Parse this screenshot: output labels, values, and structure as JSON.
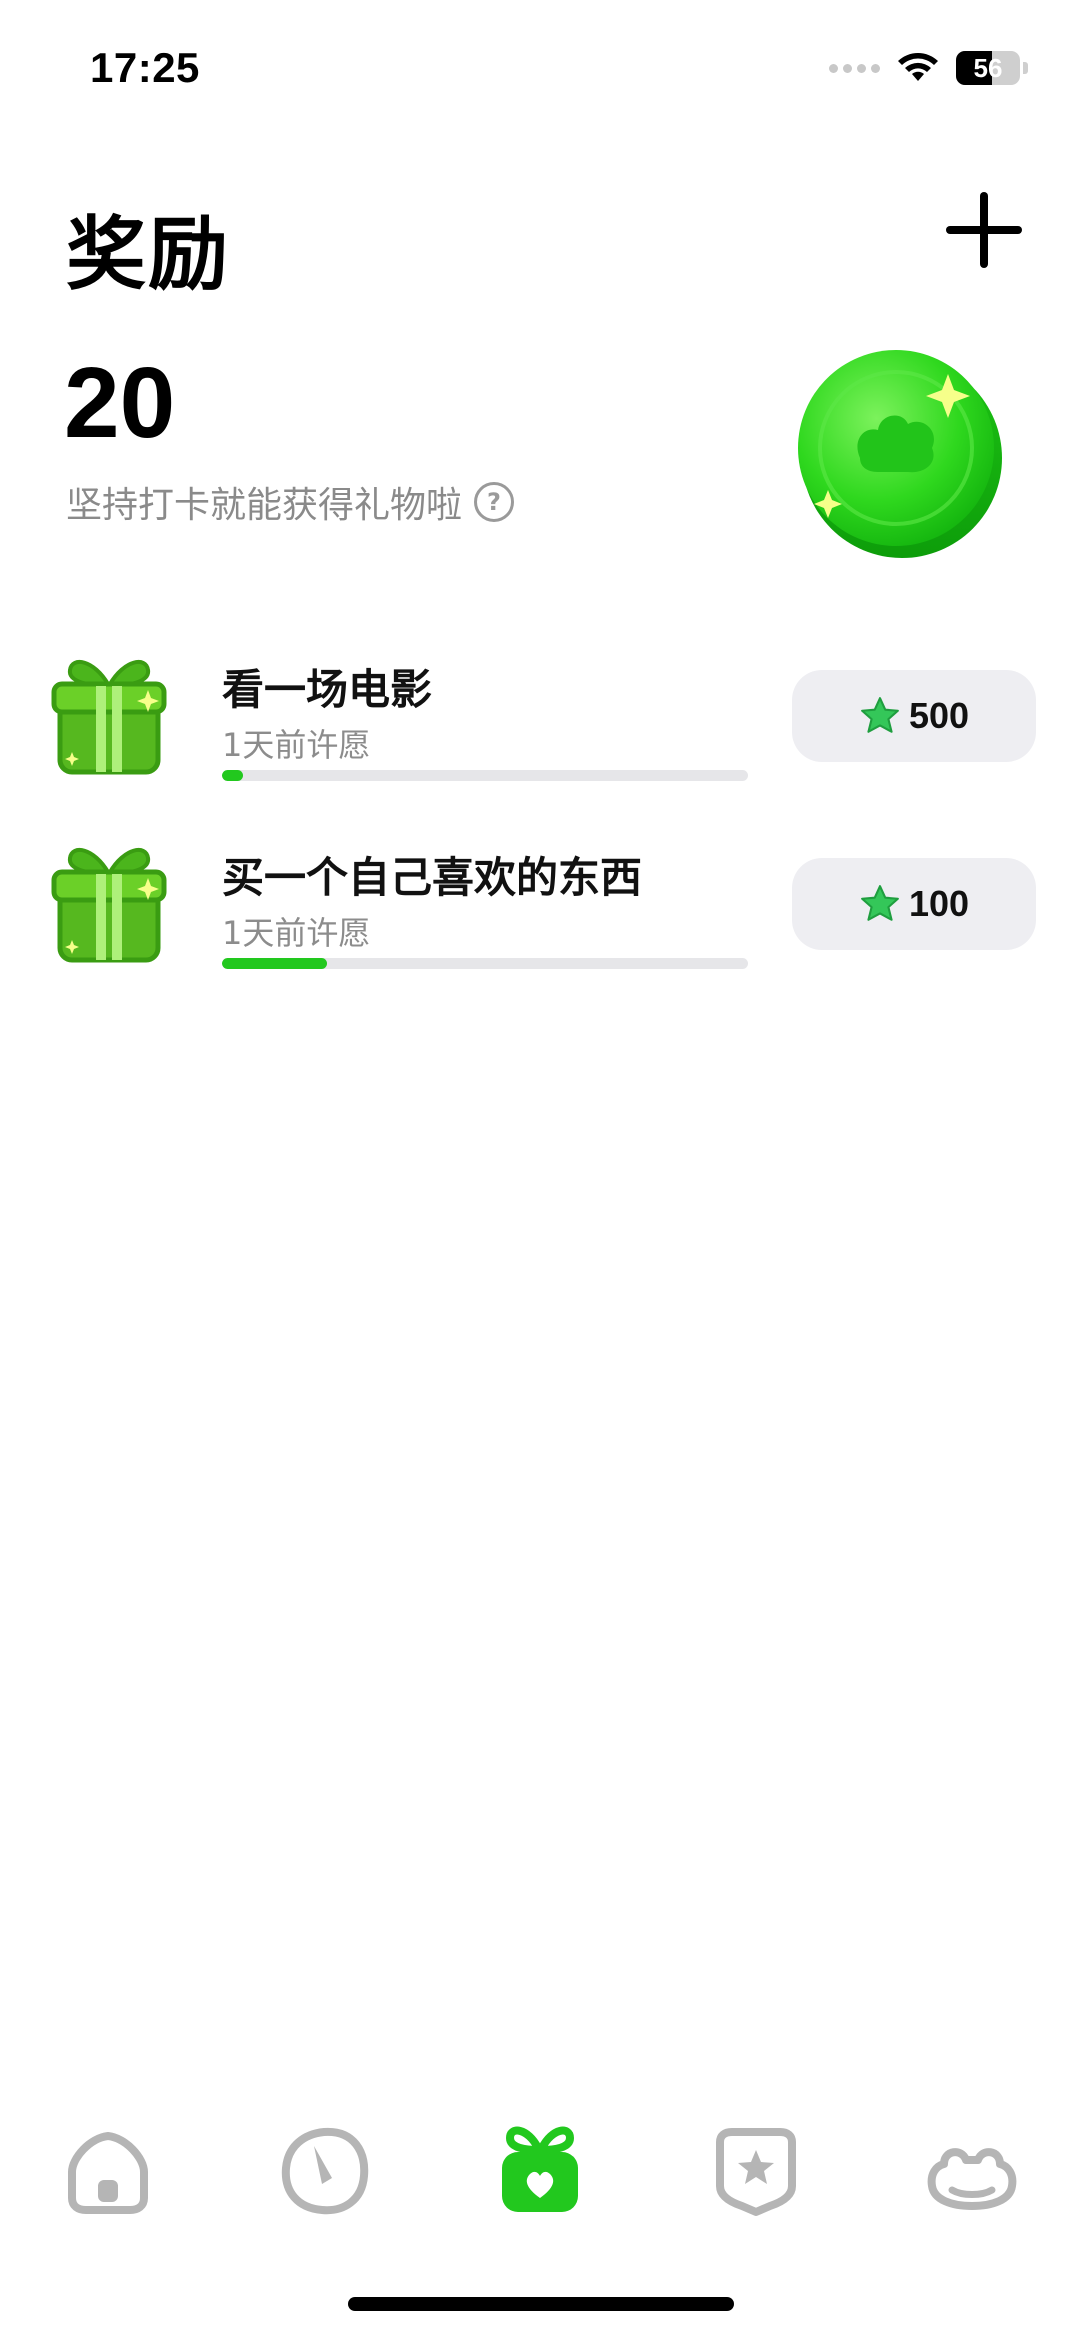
{
  "status_bar": {
    "time": "17:25",
    "battery": "56"
  },
  "header": {
    "title": "奖励"
  },
  "points": {
    "value": "20",
    "subtitle": "坚持打卡就能获得礼物啦",
    "help": "?"
  },
  "rewards": [
    {
      "title": "看一场电影",
      "date": "1天前许愿",
      "cost": "500",
      "progress": 0.04
    },
    {
      "title": "买一个自己喜欢的东西",
      "date": "1天前许愿",
      "cost": "100",
      "progress": 0.2
    }
  ],
  "tab_bar": {
    "items": [
      {
        "name": "home",
        "icon": "home-icon",
        "active": false
      },
      {
        "name": "stats",
        "icon": "gauge-icon",
        "active": false
      },
      {
        "name": "rewards",
        "icon": "gift-icon",
        "active": true
      },
      {
        "name": "achievements",
        "icon": "star-badge-icon",
        "active": false
      },
      {
        "name": "profile",
        "icon": "frog-icon",
        "active": false
      }
    ]
  },
  "colors": {
    "accent": "#22c81e",
    "pill_bg": "#eeeef2",
    "muted_text": "#8a8a8a",
    "inactive_icon": "#b5b5b5"
  }
}
